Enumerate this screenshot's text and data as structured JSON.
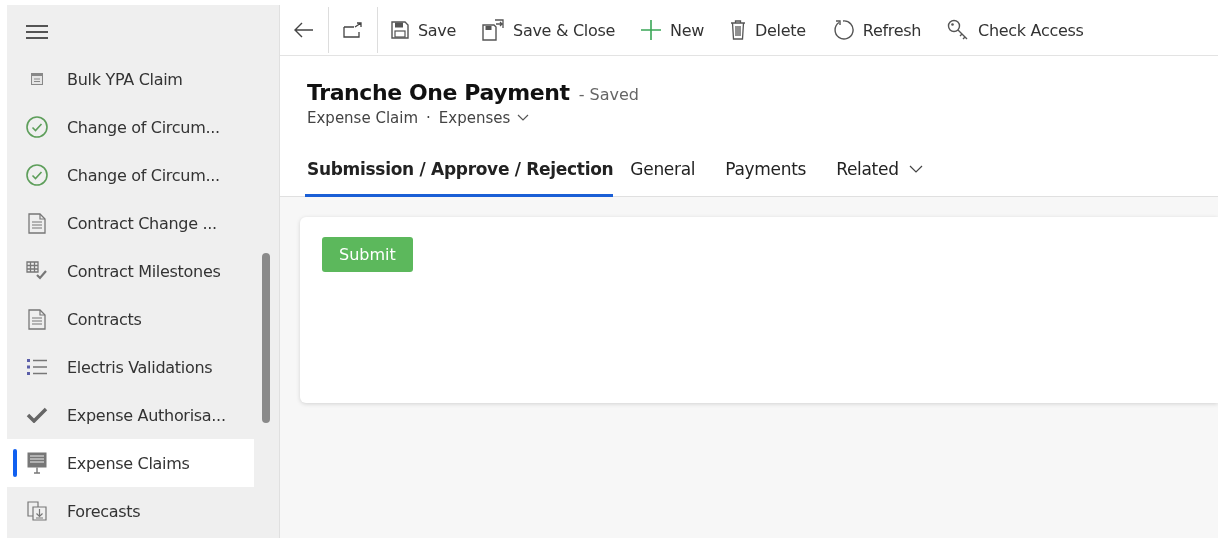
{
  "sidebar": {
    "items": [
      {
        "label": "Bulk YPA Claim",
        "kind": "form",
        "selected": false
      },
      {
        "label": "Change of Circum...",
        "kind": "check-circle",
        "selected": false
      },
      {
        "label": "Change of Circum...",
        "kind": "check-circle",
        "selected": false
      },
      {
        "label": "Contract Change ...",
        "kind": "document",
        "selected": false
      },
      {
        "label": "Contract Milestones",
        "kind": "grid-check",
        "selected": false
      },
      {
        "label": "Contracts",
        "kind": "document",
        "selected": false
      },
      {
        "label": "Electris Validations",
        "kind": "list",
        "selected": false
      },
      {
        "label": "Expense Authorisa...",
        "kind": "check",
        "selected": false
      },
      {
        "label": "Expense Claims",
        "kind": "board",
        "selected": true
      },
      {
        "label": "Forecasts",
        "kind": "import",
        "selected": false
      }
    ]
  },
  "toolbar": [
    {
      "label": "Save",
      "kind": "save"
    },
    {
      "label": "Save & Close",
      "kind": "save-close"
    },
    {
      "label": "New",
      "kind": "plus"
    },
    {
      "label": "Delete",
      "kind": "trash"
    },
    {
      "label": "Refresh",
      "kind": "refresh"
    },
    {
      "label": "Check Access",
      "kind": "key"
    }
  ],
  "record": {
    "title": "Tranche One Payment",
    "status": "- Saved",
    "entity": "Expense Claim",
    "separator": "·",
    "form": "Expenses"
  },
  "tabs": [
    {
      "label": "Submission / Approve / Rejection",
      "selected": true,
      "dropdown": false
    },
    {
      "label": "General",
      "selected": false,
      "dropdown": false
    },
    {
      "label": "Payments",
      "selected": false,
      "dropdown": false
    },
    {
      "label": "Related",
      "selected": false,
      "dropdown": true
    }
  ],
  "submit_button": "Submit"
}
